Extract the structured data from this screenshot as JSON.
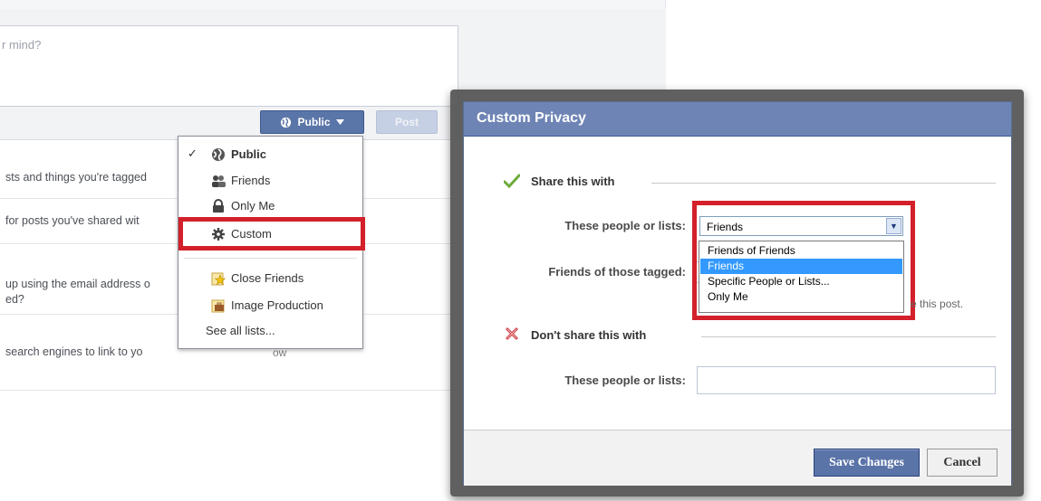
{
  "composer": {
    "placeholder": "r mind?",
    "privacy_button_label": "Public",
    "post_button_label": "Post"
  },
  "settings_rows": [
    "sts and things you're tagged",
    "for posts you've shared wit",
    "up using the email address o",
    "ed?",
    "search engines to link to yo"
  ],
  "settings_row_value": "ow",
  "privacy_menu": {
    "items": [
      {
        "label": "Public",
        "icon": "globe-icon",
        "checked": true
      },
      {
        "label": "Friends",
        "icon": "friends-icon"
      },
      {
        "label": "Only Me",
        "icon": "lock-icon"
      },
      {
        "label": "Custom",
        "icon": "gear-icon"
      },
      {
        "label": "Close Friends",
        "icon": "star-list-icon"
      },
      {
        "label": "Image Production",
        "icon": "briefcase-list-icon"
      },
      {
        "label": "See all lists...",
        "icon": ""
      }
    ],
    "check_mark": "✓"
  },
  "dialog": {
    "title": "Custom Privacy",
    "share_section": "Share this with",
    "share_label": "These people or lists:",
    "selected_value": "Friends",
    "options": [
      "Friends of Friends",
      "Friends",
      "Specific People or Lists...",
      "Only Me"
    ],
    "selected_option_index": 1,
    "tagged_label": "Friends of those tagged:",
    "note_fragment": "e this post.",
    "dont_share_section": "Don't share this with",
    "dont_share_label": "These people or lists:",
    "save_label": "Save Changes",
    "cancel_label": "Cancel"
  },
  "colors": {
    "dialog_title_bg": "#6d84b4",
    "highlight_red": "#d3202a",
    "selected_option": "#3399ff",
    "share_check_green": "#6dab3c",
    "dont_share_x": "#c9363e"
  }
}
